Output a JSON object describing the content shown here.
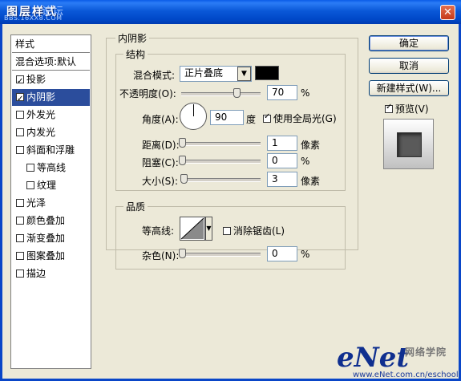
{
  "window": {
    "title": "图层样式",
    "title_watermark": "论坛",
    "title_watermark_url": "BBS.16XX8.COM",
    "close_label": "✕"
  },
  "sidebar": {
    "header": "样式",
    "blend_options": "混合选项:默认",
    "items": [
      {
        "label": "投影",
        "checked": true,
        "selected": false,
        "indent": false
      },
      {
        "label": "内阴影",
        "checked": true,
        "selected": true,
        "indent": false
      },
      {
        "label": "外发光",
        "checked": false,
        "selected": false,
        "indent": false
      },
      {
        "label": "内发光",
        "checked": false,
        "selected": false,
        "indent": false
      },
      {
        "label": "斜面和浮雕",
        "checked": false,
        "selected": false,
        "indent": false
      },
      {
        "label": "等高线",
        "checked": false,
        "selected": false,
        "indent": true
      },
      {
        "label": "纹理",
        "checked": false,
        "selected": false,
        "indent": true
      },
      {
        "label": "光泽",
        "checked": false,
        "selected": false,
        "indent": false
      },
      {
        "label": "颜色叠加",
        "checked": false,
        "selected": false,
        "indent": false
      },
      {
        "label": "渐变叠加",
        "checked": false,
        "selected": false,
        "indent": false
      },
      {
        "label": "图案叠加",
        "checked": false,
        "selected": false,
        "indent": false
      },
      {
        "label": "描边",
        "checked": false,
        "selected": false,
        "indent": false
      }
    ]
  },
  "inner_shadow": {
    "group_title": "内阴影",
    "structure": {
      "title": "结构",
      "blend_mode_label": "混合模式:",
      "blend_mode_value": "正片叠底",
      "shadow_color": "#000000",
      "opacity_label": "不透明度(O):",
      "opacity_value": "70",
      "opacity_unit": "%",
      "opacity_level": 0.7,
      "angle_label": "角度(A):",
      "angle_value": "90",
      "angle_unit": "度",
      "global_light_label": "使用全局光(G)",
      "global_light_checked": true,
      "distance_label": "距离(D):",
      "distance_value": "1",
      "distance_unit": "像素",
      "choke_label": "阻塞(C):",
      "choke_value": "0",
      "choke_unit": "%",
      "size_label": "大小(S):",
      "size_value": "3",
      "size_unit": "像素"
    },
    "quality": {
      "title": "品质",
      "contour_label": "等高线:",
      "antialias_label": "消除锯齿(L)",
      "antialias_checked": false,
      "noise_label": "杂色(N):",
      "noise_value": "0",
      "noise_unit": "%"
    }
  },
  "buttons": {
    "ok": "确定",
    "cancel": "取消",
    "new_style": "新建样式(W)...",
    "preview_label": "预览(V)",
    "preview_checked": true
  },
  "watermark": {
    "brand": "eNet",
    "cn": "网络学院",
    "url": "www.eNet.com.cn/eschool"
  }
}
